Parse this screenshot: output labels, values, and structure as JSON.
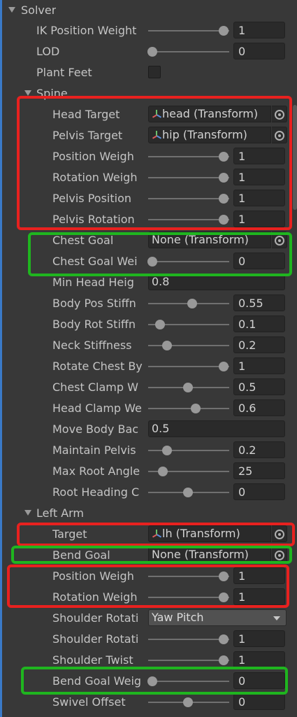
{
  "solver": {
    "header": "Solver",
    "ik_position_weight": {
      "label": "IK Position Weight",
      "value": "1",
      "slider": 1.0
    },
    "lod": {
      "label": "LOD",
      "value": "0",
      "slider": 0.0
    },
    "plant_feet": {
      "label": "Plant Feet",
      "checked": false
    }
  },
  "spine": {
    "header": "Spine",
    "head_target": {
      "label": "Head Target",
      "value": "head (Transform)"
    },
    "pelvis_target": {
      "label": "Pelvis Target",
      "value": "hip (Transform)"
    },
    "position_weight": {
      "label": "Position Weigh",
      "value": "1",
      "slider": 1.0
    },
    "rotation_weight": {
      "label": "Rotation Weigh",
      "value": "1",
      "slider": 1.0
    },
    "pelvis_position": {
      "label": "Pelvis Position",
      "value": "1",
      "slider": 1.0
    },
    "pelvis_rotation": {
      "label": "Pelvis Rotation",
      "value": "1",
      "slider": 1.0
    },
    "chest_goal": {
      "label": "Chest Goal",
      "value": "None (Transform)"
    },
    "chest_goal_weight": {
      "label": "Chest Goal Wei",
      "value": "0",
      "slider": 0.0
    },
    "min_head_height": {
      "label": "Min Head Heig",
      "value": "0.8"
    },
    "body_pos_stiffness": {
      "label": "Body Pos Stiffn",
      "value": "0.55",
      "slider": 0.55
    },
    "body_rot_stiffness": {
      "label": "Body Rot Stiffn",
      "value": "0.1",
      "slider": 0.1
    },
    "neck_stiffness": {
      "label": "Neck Stiffness",
      "value": "0.2",
      "slider": 0.2
    },
    "rotate_chest_by": {
      "label": "Rotate Chest By",
      "value": "1",
      "slider": 1.0
    },
    "chest_clamp_weight": {
      "label": "Chest Clamp W",
      "value": "0.5",
      "slider": 0.5
    },
    "head_clamp_weight": {
      "label": "Head Clamp We",
      "value": "0.6",
      "slider": 0.6
    },
    "move_body_back": {
      "label": "Move Body Bac",
      "value": "0.5"
    },
    "maintain_pelvis": {
      "label": "Maintain Pelvis",
      "value": "0.2",
      "slider": 0.2
    },
    "max_root_angle": {
      "label": "Max Root Angle",
      "value": "25",
      "slider": 0.14
    },
    "root_heading_offset": {
      "label": "Root Heading C",
      "value": "0",
      "slider": 0.5
    }
  },
  "left_arm": {
    "header": "Left Arm",
    "target": {
      "label": "Target",
      "value": "lh (Transform)"
    },
    "bend_goal": {
      "label": "Bend Goal",
      "value": "None (Transform)"
    },
    "position_weight": {
      "label": "Position Weigh",
      "value": "1",
      "slider": 1.0
    },
    "rotation_weight": {
      "label": "Rotation Weigh",
      "value": "1",
      "slider": 1.0
    },
    "shoulder_rotation_mode": {
      "label": "Shoulder Rotati",
      "value": "Yaw Pitch"
    },
    "shoulder_rotation_weight": {
      "label": "Shoulder Rotati",
      "value": "1",
      "slider": 1.0
    },
    "shoulder_twist_weight": {
      "label": "Shoulder Twist",
      "value": "1",
      "slider": 1.0
    },
    "bend_goal_weight": {
      "label": "Bend Goal Weig",
      "value": "0",
      "slider": 0.0
    },
    "swivel_offset": {
      "label": "Swivel Offset",
      "value": "0",
      "slider": 0.5
    }
  },
  "colors": {
    "highlight_red": "#e8211f",
    "highlight_green": "#1fb51f",
    "background": "#383838"
  }
}
